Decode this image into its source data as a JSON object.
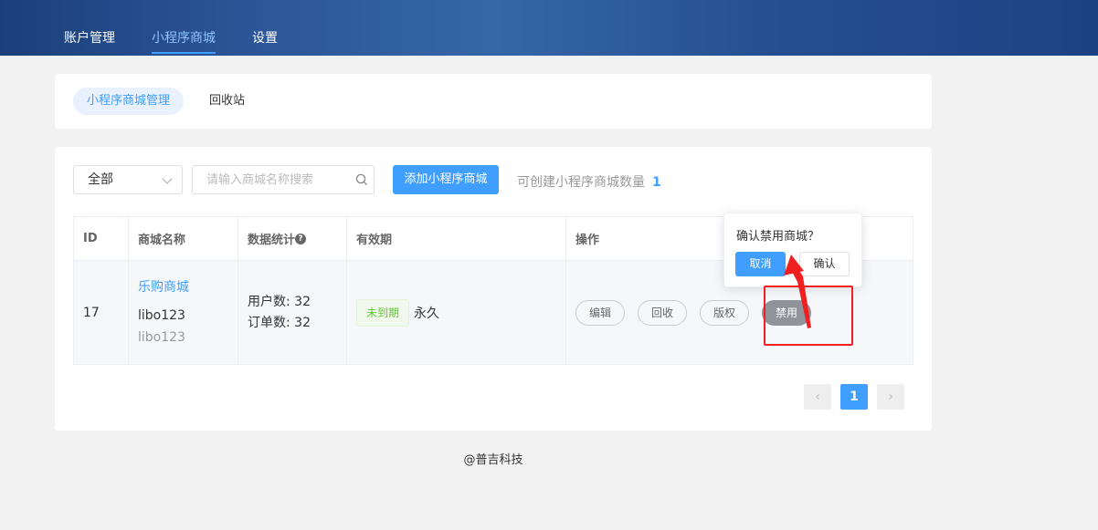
{
  "topnav": {
    "items": [
      {
        "label": "账户管理",
        "active": false
      },
      {
        "label": "小程序商城",
        "active": true
      },
      {
        "label": "设置",
        "active": false
      }
    ]
  },
  "subnav": {
    "tabs": [
      {
        "label": "小程序商城管理",
        "active": true
      },
      {
        "label": "回收站",
        "active": false
      }
    ]
  },
  "filters": {
    "select_value": "全部",
    "search_placeholder": "请输入商城名称搜索",
    "add_button": "添加小程序商城",
    "quota_label": "可创建小程序商城数量",
    "quota_value": "1"
  },
  "table": {
    "headers": {
      "id": "ID",
      "name": "商城名称",
      "stats": "数据统计",
      "stats_help": "?",
      "validity": "有效期",
      "actions": "操作"
    },
    "rows": [
      {
        "id": "17",
        "shop_name": "乐购商城",
        "user_primary": "libo123",
        "user_secondary": "libo123",
        "users_stat": "用户数: 32",
        "orders_stat": "订单数: 32",
        "status_tag": "未到期",
        "validity": "永久",
        "actions": {
          "edit": "编辑",
          "recycle": "回收",
          "copyright": "版权",
          "disable": "禁用"
        }
      }
    ]
  },
  "pagination": {
    "prev": "‹",
    "current": "1",
    "next": "›"
  },
  "popover": {
    "message": "确认禁用商城？",
    "cancel": "取消",
    "confirm": "确认"
  },
  "footer": {
    "text": "@普吉科技"
  },
  "colors": {
    "accent": "#409eff",
    "annotation": "#f02020",
    "header_bg": "#2a5394"
  }
}
